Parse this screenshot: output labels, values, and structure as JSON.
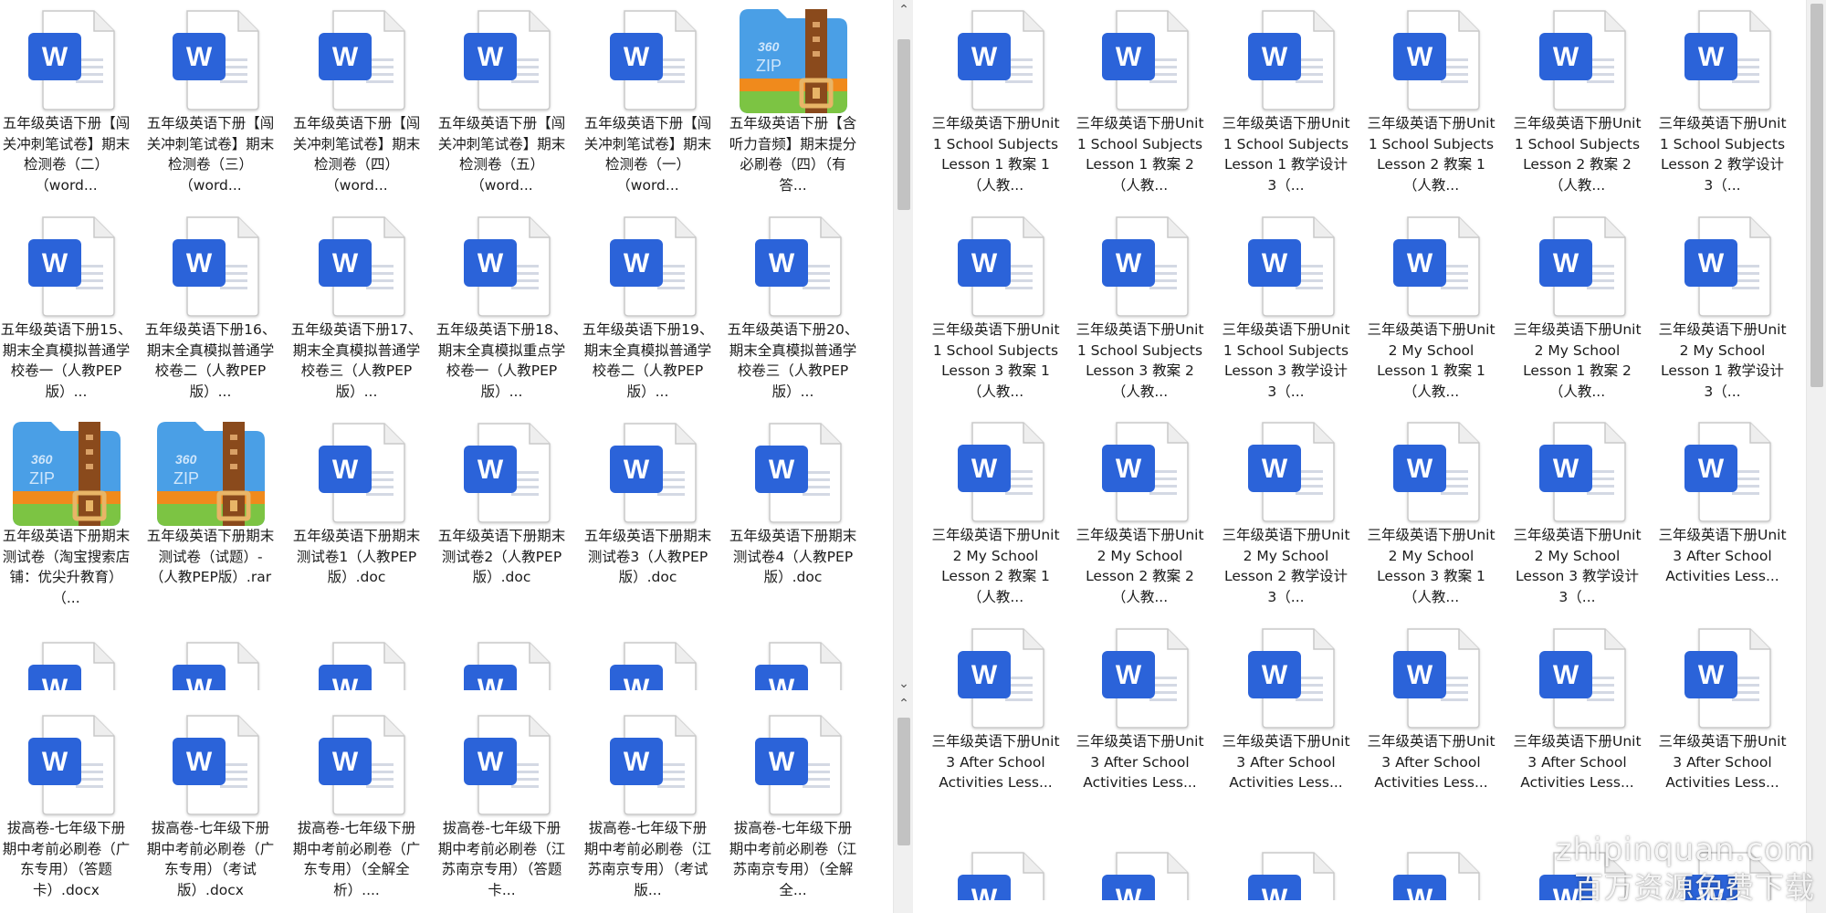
{
  "left_panel": {
    "files": [
      {
        "type": "word",
        "name": "五年级英语下册【闯关冲刺笔试卷】期末检测卷（二）（word..."
      },
      {
        "type": "word",
        "name": "五年级英语下册【闯关冲刺笔试卷】期末检测卷（三）（word..."
      },
      {
        "type": "word",
        "name": "五年级英语下册【闯关冲刺笔试卷】期末检测卷（四）（word..."
      },
      {
        "type": "word",
        "name": "五年级英语下册【闯关冲刺笔试卷】期末检测卷（五）（word..."
      },
      {
        "type": "word",
        "name": "五年级英语下册【闯关冲刺笔试卷】期末检测卷（一）（word..."
      },
      {
        "type": "zip",
        "name": "五年级英语下册【含听力音频】期末提分必刷卷（四）（有答..."
      },
      {
        "type": "word",
        "name": "五年级英语下册15、期末全真模拟普通学校卷一（人教PEP版）..."
      },
      {
        "type": "word",
        "name": "五年级英语下册16、期末全真模拟普通学校卷二（人教PEP版）..."
      },
      {
        "type": "word",
        "name": "五年级英语下册17、期末全真模拟普通学校卷三（人教PEP版）..."
      },
      {
        "type": "word",
        "name": "五年级英语下册18、期末全真模拟重点学校卷一（人教PEP版）..."
      },
      {
        "type": "word",
        "name": "五年级英语下册19、期末全真模拟普通学校卷二（人教PEP版）..."
      },
      {
        "type": "word",
        "name": "五年级英语下册20、期末全真模拟普通学校卷三（人教PEP版）..."
      },
      {
        "type": "zip",
        "name": "五年级英语下册期末测试卷（淘宝搜索店铺：优尖升教育）（..."
      },
      {
        "type": "zip",
        "name": "五年级英语下册期末测试卷（试题）-（人教PEP版）.rar"
      },
      {
        "type": "word",
        "name": "五年级英语下册期末测试卷1（人教PEP版）.doc"
      },
      {
        "type": "word",
        "name": "五年级英语下册期末测试卷2（人教PEP版）.doc"
      },
      {
        "type": "word",
        "name": "五年级英语下册期末测试卷3（人教PEP版）.doc"
      },
      {
        "type": "word",
        "name": "五年级英语下册期末测试卷4（人教PEP版）.doc"
      }
    ],
    "partial_row_count": 6,
    "bottom_files": [
      {
        "type": "word",
        "name": "拔高卷-七年级下册期中考前必刷卷（广东专用）（答题卡）.docx"
      },
      {
        "type": "word",
        "name": "拔高卷-七年级下册期中考前必刷卷（广东专用）（考试版）.docx"
      },
      {
        "type": "word",
        "name": "拔高卷-七年级下册期中考前必刷卷（广东专用）（全解全析）...."
      },
      {
        "type": "word",
        "name": "拔高卷-七年级下册期中考前必刷卷（江苏南京专用）（答题卡..."
      },
      {
        "type": "word",
        "name": "拔高卷-七年级下册期中考前必刷卷（江苏南京专用）（考试版..."
      },
      {
        "type": "word",
        "name": "拔高卷-七年级下册期中考前必刷卷（江苏南京专用）（全解全..."
      }
    ]
  },
  "right_panel": {
    "files": [
      {
        "type": "word",
        "name": "三年级英语下册Unit 1 School Subjects Lesson 1 教案 1（人教..."
      },
      {
        "type": "word",
        "name": "三年级英语下册Unit 1 School Subjects Lesson 1 教案 2（人教..."
      },
      {
        "type": "word",
        "name": "三年级英语下册Unit 1 School Subjects Lesson 1 教学设计 3（..."
      },
      {
        "type": "word",
        "name": "三年级英语下册Unit 1 School Subjects Lesson 2 教案 1（人教..."
      },
      {
        "type": "word",
        "name": "三年级英语下册Unit 1 School Subjects Lesson 2 教案 2（人教..."
      },
      {
        "type": "word",
        "name": "三年级英语下册Unit 1 School Subjects Lesson 2 教学设计 3（..."
      },
      {
        "type": "word",
        "name": "三年级英语下册Unit 1 School Subjects Lesson 3 教案 1（人教..."
      },
      {
        "type": "word",
        "name": "三年级英语下册Unit 1 School Subjects Lesson 3 教案 2（人教..."
      },
      {
        "type": "word",
        "name": "三年级英语下册Unit 1 School Subjects Lesson 3 教学设计 3（..."
      },
      {
        "type": "word",
        "name": "三年级英语下册Unit 2 My School Lesson 1 教案 1（人教..."
      },
      {
        "type": "word",
        "name": "三年级英语下册Unit 2 My School Lesson 1 教案 2（人教..."
      },
      {
        "type": "word",
        "name": "三年级英语下册Unit 2 My School Lesson 1 教学设计 3（..."
      },
      {
        "type": "word",
        "name": "三年级英语下册Unit 2 My School Lesson 2 教案 1（人教..."
      },
      {
        "type": "word",
        "name": "三年级英语下册Unit 2 My School Lesson 2 教案 2（人教..."
      },
      {
        "type": "word",
        "name": "三年级英语下册Unit 2 My School Lesson 2 教学设计 3（..."
      },
      {
        "type": "word",
        "name": "三年级英语下册Unit 2 My School Lesson 3 教案 1（人教..."
      },
      {
        "type": "word",
        "name": "三年级英语下册Unit 2 My School Lesson 3 教学设计 3（..."
      },
      {
        "type": "word",
        "name": "三年级英语下册Unit 3 After School Activities Less..."
      },
      {
        "type": "word",
        "name": "三年级英语下册Unit 3 After School Activities Less..."
      },
      {
        "type": "word",
        "name": "三年级英语下册Unit 3 After School Activities Less..."
      },
      {
        "type": "word",
        "name": "三年级英语下册Unit 3 After School Activities Less..."
      },
      {
        "type": "word",
        "name": "三年级英语下册Unit 3 After School Activities Less..."
      },
      {
        "type": "word",
        "name": "三年级英语下册Unit 3 After School Activities Less..."
      },
      {
        "type": "word",
        "name": "三年级英语下册Unit 3 After School Activities Less..."
      }
    ],
    "partial_row_count": 6
  },
  "watermark": {
    "line1": "zhipinquan.com",
    "line2": "百万资源免费下载"
  },
  "colors": {
    "word_blue": "#2b63d9",
    "zip_blue": "#4a9fe6",
    "zip_orange": "#f08a1c",
    "zip_green": "#7cc443",
    "zip_brown": "#8a4a1c",
    "scroll_track": "#f0f0f0",
    "scroll_thumb": "#c2c2c2"
  },
  "left_scroll_thumb": {
    "top_fraction": 0.03,
    "size_fraction": 0.26
  },
  "right_scroll_thumb": {
    "top_fraction": 0.0,
    "size_fraction": 0.42
  }
}
